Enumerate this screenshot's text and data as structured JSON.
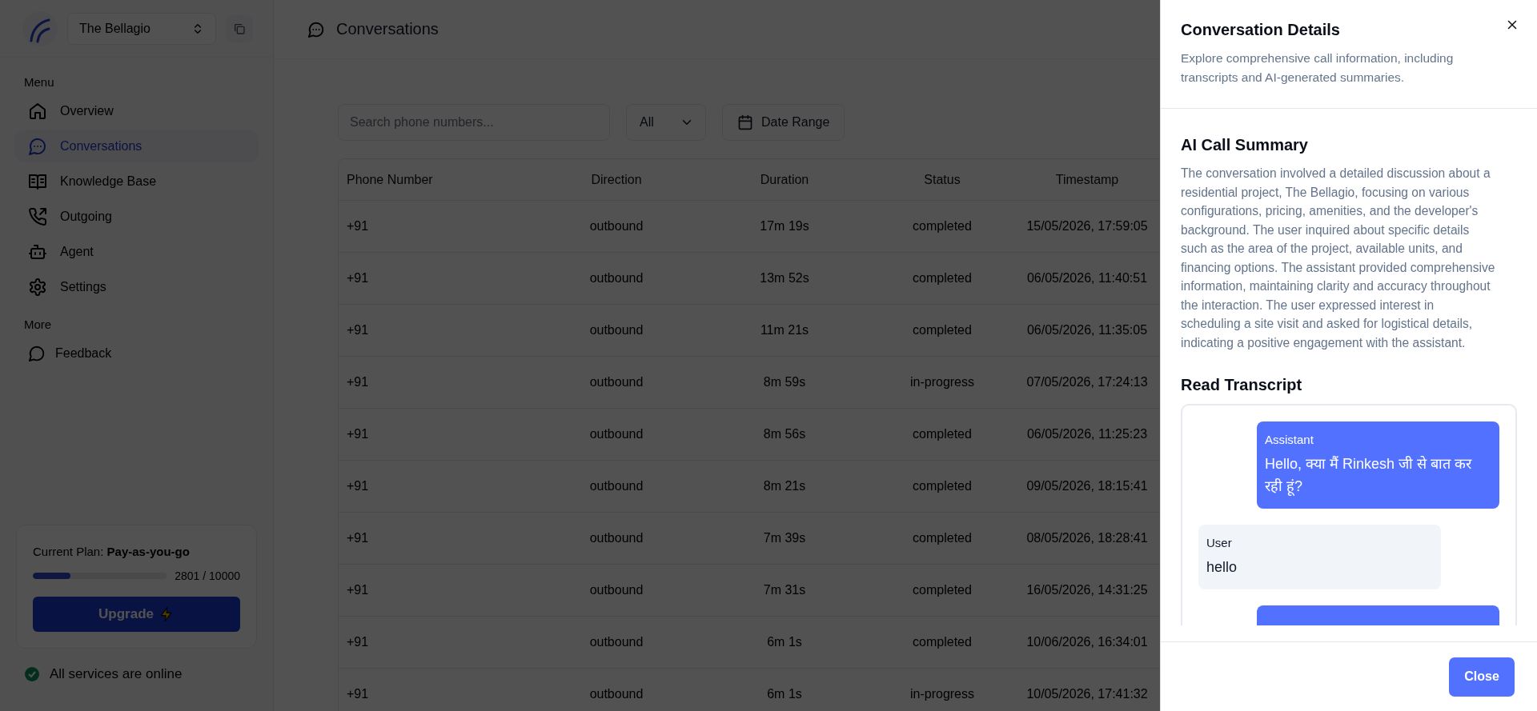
{
  "sidebar": {
    "project": "The Bellagio",
    "menu_heading": "Menu",
    "items": [
      {
        "label": "Overview",
        "selected": false
      },
      {
        "label": "Conversations",
        "selected": true
      },
      {
        "label": "Knowledge Base",
        "selected": false
      },
      {
        "label": "Outgoing",
        "selected": false
      },
      {
        "label": "Agent",
        "selected": false
      },
      {
        "label": "Settings",
        "selected": false
      }
    ],
    "more_heading": "More",
    "more_items": [
      {
        "label": "Feedback"
      }
    ],
    "plan": {
      "label": "Current Plan: **Pay-as-you-go**",
      "level": 0.28,
      "usage": "2801 / 10000",
      "button": "Upgrade"
    },
    "status": "All services are online"
  },
  "header": {
    "title": "Conversations"
  },
  "filters": {
    "search": {
      "placeholder": "Search phone numbers..."
    },
    "direction": "All",
    "date_button": "Date Range"
  },
  "table": {
    "columns": [
      "Phone Number",
      "Direction",
      "Duration",
      "Status",
      "Timestamp"
    ],
    "rows": [
      [
        "+91",
        "outbound",
        "17m 19s",
        "completed",
        "15/05/2026, 17:59:05"
      ],
      [
        "+91",
        "outbound",
        "13m 52s",
        "completed",
        "06/05/2026, 11:40:51"
      ],
      [
        "+91",
        "outbound",
        "11m 21s",
        "completed",
        "06/05/2026, 11:35:05"
      ],
      [
        "+91",
        "outbound",
        "8m 59s",
        "in-progress",
        "07/05/2026, 17:24:13"
      ],
      [
        "+91",
        "outbound",
        "8m 56s",
        "completed",
        "06/05/2026, 11:25:23"
      ],
      [
        "+91",
        "outbound",
        "8m 21s",
        "completed",
        "09/05/2026, 18:15:41"
      ],
      [
        "+91",
        "outbound",
        "7m 39s",
        "completed",
        "08/05/2026, 18:28:41"
      ],
      [
        "+91",
        "outbound",
        "7m 31s",
        "completed",
        "16/05/2026, 14:31:25"
      ],
      [
        "+91",
        "outbound",
        "6m 1s",
        "completed",
        "10/06/2026, 16:34:01"
      ],
      [
        "+91",
        "outbound",
        "6m 1s",
        "in-progress",
        "10/05/2026, 17:41:32"
      ]
    ]
  },
  "panel": {
    "title": "Conversation Details",
    "description": "Explore comprehensive call information, including transcripts and AI-generated summaries.",
    "summary_heading": "AI Call Summary",
    "summary": "The conversation involved a detailed discussion about a residential project, The Bellagio, focusing on various configurations, pricing, amenities, and the developer's background. The user inquired about specific details such as the area of the project, available units, and financing options. The assistant provided comprehensive information, maintaining clarity and accuracy throughout the interaction. The user expressed interest in scheduling a site visit and asked for logistical details, indicating a positive engagement with the assistant.",
    "transcript_heading": "Read Transcript",
    "messages": [
      {
        "kind": "assistant",
        "speaker": "Assistant",
        "text": "Hello, क्या मैं Rinkesh जी से बात कर रही हूं?"
      },
      {
        "kind": "user",
        "speaker": "User",
        "text": "hello"
      },
      {
        "kind": "assistant"
      }
    ],
    "close_button": "Close"
  }
}
